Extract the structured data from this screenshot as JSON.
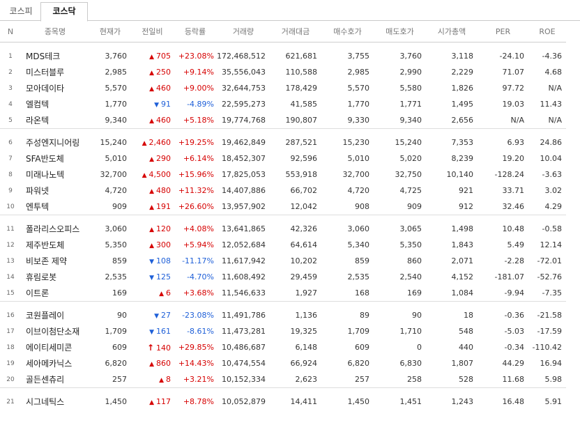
{
  "tabs": [
    {
      "label": "코스피",
      "active": false
    },
    {
      "label": "코스닥",
      "active": true
    }
  ],
  "headers": {
    "n": "N",
    "name": "종목명",
    "price": "현재가",
    "change": "전일비",
    "rate": "등락률",
    "volume": "거래량",
    "amount": "거래대금",
    "bid": "매수호가",
    "ask": "매도호가",
    "cap": "시가총액",
    "per": "PER",
    "roe": "ROE"
  },
  "colors": {
    "up": "#d60000",
    "down": "#1e5fd8"
  },
  "rows": [
    {
      "n": "1",
      "name": "MDS테크",
      "price": "3,760",
      "dir": "up",
      "change": "705",
      "rate": "+23.08%",
      "volume": "172,468,512",
      "amount": "621,681",
      "bid": "3,755",
      "ask": "3,760",
      "cap": "3,118",
      "per": "-24.10",
      "roe": "-4.36"
    },
    {
      "n": "2",
      "name": "미스터블루",
      "price": "2,985",
      "dir": "up",
      "change": "250",
      "rate": "+9.14%",
      "volume": "35,556,043",
      "amount": "110,588",
      "bid": "2,985",
      "ask": "2,990",
      "cap": "2,229",
      "per": "71.07",
      "roe": "4.68"
    },
    {
      "n": "3",
      "name": "모아데이타",
      "price": "5,570",
      "dir": "up",
      "change": "460",
      "rate": "+9.00%",
      "volume": "32,644,753",
      "amount": "178,429",
      "bid": "5,570",
      "ask": "5,580",
      "cap": "1,826",
      "per": "97.72",
      "roe": "N/A"
    },
    {
      "n": "4",
      "name": "엘컴텍",
      "price": "1,770",
      "dir": "down",
      "change": "91",
      "rate": "-4.89%",
      "volume": "22,595,273",
      "amount": "41,585",
      "bid": "1,770",
      "ask": "1,771",
      "cap": "1,495",
      "per": "19.03",
      "roe": "11.43"
    },
    {
      "n": "5",
      "name": "라온텍",
      "price": "9,340",
      "dir": "up",
      "change": "460",
      "rate": "+5.18%",
      "volume": "19,774,768",
      "amount": "190,807",
      "bid": "9,330",
      "ask": "9,340",
      "cap": "2,656",
      "per": "N/A",
      "roe": "N/A"
    },
    {
      "n": "6",
      "name": "주성엔지니어링",
      "price": "15,240",
      "dir": "up",
      "change": "2,460",
      "rate": "+19.25%",
      "volume": "19,462,849",
      "amount": "287,521",
      "bid": "15,230",
      "ask": "15,240",
      "cap": "7,353",
      "per": "6.93",
      "roe": "24.86"
    },
    {
      "n": "7",
      "name": "SFA반도체",
      "price": "5,010",
      "dir": "up",
      "change": "290",
      "rate": "+6.14%",
      "volume": "18,452,307",
      "amount": "92,596",
      "bid": "5,010",
      "ask": "5,020",
      "cap": "8,239",
      "per": "19.20",
      "roe": "10.04"
    },
    {
      "n": "8",
      "name": "미래나노텍",
      "price": "32,700",
      "dir": "up",
      "change": "4,500",
      "rate": "+15.96%",
      "volume": "17,825,053",
      "amount": "553,918",
      "bid": "32,700",
      "ask": "32,750",
      "cap": "10,140",
      "per": "-128.24",
      "roe": "-3.63"
    },
    {
      "n": "9",
      "name": "파워넷",
      "price": "4,720",
      "dir": "up",
      "change": "480",
      "rate": "+11.32%",
      "volume": "14,407,886",
      "amount": "66,702",
      "bid": "4,720",
      "ask": "4,725",
      "cap": "921",
      "per": "33.71",
      "roe": "3.02"
    },
    {
      "n": "10",
      "name": "엔투텍",
      "price": "909",
      "dir": "up",
      "change": "191",
      "rate": "+26.60%",
      "volume": "13,957,902",
      "amount": "12,042",
      "bid": "908",
      "ask": "909",
      "cap": "912",
      "per": "32.46",
      "roe": "4.29"
    },
    {
      "n": "11",
      "name": "폴라리스오피스",
      "price": "3,060",
      "dir": "up",
      "change": "120",
      "rate": "+4.08%",
      "volume": "13,641,865",
      "amount": "42,326",
      "bid": "3,060",
      "ask": "3,065",
      "cap": "1,498",
      "per": "10.48",
      "roe": "-0.58"
    },
    {
      "n": "12",
      "name": "제주반도체",
      "price": "5,350",
      "dir": "up",
      "change": "300",
      "rate": "+5.94%",
      "volume": "12,052,684",
      "amount": "64,614",
      "bid": "5,340",
      "ask": "5,350",
      "cap": "1,843",
      "per": "5.49",
      "roe": "12.14"
    },
    {
      "n": "13",
      "name": "비보존 제약",
      "price": "859",
      "dir": "down",
      "change": "108",
      "rate": "-11.17%",
      "volume": "11,617,942",
      "amount": "10,202",
      "bid": "859",
      "ask": "860",
      "cap": "2,071",
      "per": "-2.28",
      "roe": "-72.01"
    },
    {
      "n": "14",
      "name": "휴림로봇",
      "price": "2,535",
      "dir": "down",
      "change": "125",
      "rate": "-4.70%",
      "volume": "11,608,492",
      "amount": "29,459",
      "bid": "2,535",
      "ask": "2,540",
      "cap": "4,152",
      "per": "-181.07",
      "roe": "-52.76"
    },
    {
      "n": "15",
      "name": "이트론",
      "price": "169",
      "dir": "up",
      "change": "6",
      "rate": "+3.68%",
      "volume": "11,546,633",
      "amount": "1,927",
      "bid": "168",
      "ask": "169",
      "cap": "1,084",
      "per": "-9.94",
      "roe": "-7.35"
    },
    {
      "n": "16",
      "name": "코원플레이",
      "price": "90",
      "dir": "down",
      "change": "27",
      "rate": "-23.08%",
      "volume": "11,491,786",
      "amount": "1,136",
      "bid": "89",
      "ask": "90",
      "cap": "18",
      "per": "-0.36",
      "roe": "-21.58"
    },
    {
      "n": "17",
      "name": "이브이첨단소재",
      "price": "1,709",
      "dir": "down",
      "change": "161",
      "rate": "-8.61%",
      "volume": "11,473,281",
      "amount": "19,325",
      "bid": "1,709",
      "ask": "1,710",
      "cap": "548",
      "per": "-5.03",
      "roe": "-17.59"
    },
    {
      "n": "18",
      "name": "에이티세미콘",
      "price": "609",
      "dir": "limitup",
      "change": "140",
      "rate": "+29.85%",
      "volume": "10,486,687",
      "amount": "6,148",
      "bid": "609",
      "ask": "0",
      "cap": "440",
      "per": "-0.34",
      "roe": "-110.42"
    },
    {
      "n": "19",
      "name": "세아메카닉스",
      "price": "6,820",
      "dir": "up",
      "change": "860",
      "rate": "+14.43%",
      "volume": "10,474,554",
      "amount": "66,924",
      "bid": "6,820",
      "ask": "6,830",
      "cap": "1,807",
      "per": "44.29",
      "roe": "16.94"
    },
    {
      "n": "20",
      "name": "골든센츄리",
      "price": "257",
      "dir": "up",
      "change": "8",
      "rate": "+3.21%",
      "volume": "10,152,334",
      "amount": "2,623",
      "bid": "257",
      "ask": "258",
      "cap": "528",
      "per": "11.68",
      "roe": "5.98"
    },
    {
      "n": "21",
      "name": "시그네틱스",
      "price": "1,450",
      "dir": "up",
      "change": "117",
      "rate": "+8.78%",
      "volume": "10,052,879",
      "amount": "14,411",
      "bid": "1,450",
      "ask": "1,451",
      "cap": "1,243",
      "per": "16.48",
      "roe": "5.91"
    }
  ]
}
